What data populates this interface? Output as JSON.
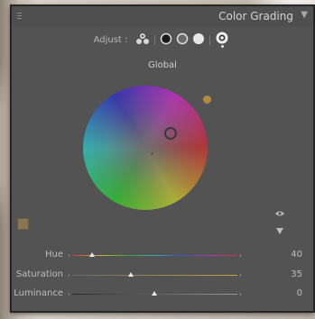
{
  "panel": {
    "title": "Color Grading",
    "adjust_label": "Adjust :",
    "section_label": "Global"
  },
  "adjust_modes": [
    {
      "name": "three-way",
      "icon": "three-circles-icon"
    },
    {
      "name": "shadows",
      "icon": "shadows-circle-icon"
    },
    {
      "name": "midtones",
      "icon": "midtones-circle-icon"
    },
    {
      "name": "highlights",
      "icon": "highlights-circle-icon"
    },
    {
      "name": "global",
      "icon": "global-circle-icon",
      "selected": true
    }
  ],
  "sliders": [
    {
      "label": "Hue",
      "value": "40"
    },
    {
      "label": "Saturation",
      "value": "35"
    },
    {
      "label": "Luminance",
      "value": "0"
    }
  ],
  "colors": {
    "panel_bg": "#535353",
    "swatch": "#8a7651",
    "saturation_handle": "#b48b3c"
  }
}
